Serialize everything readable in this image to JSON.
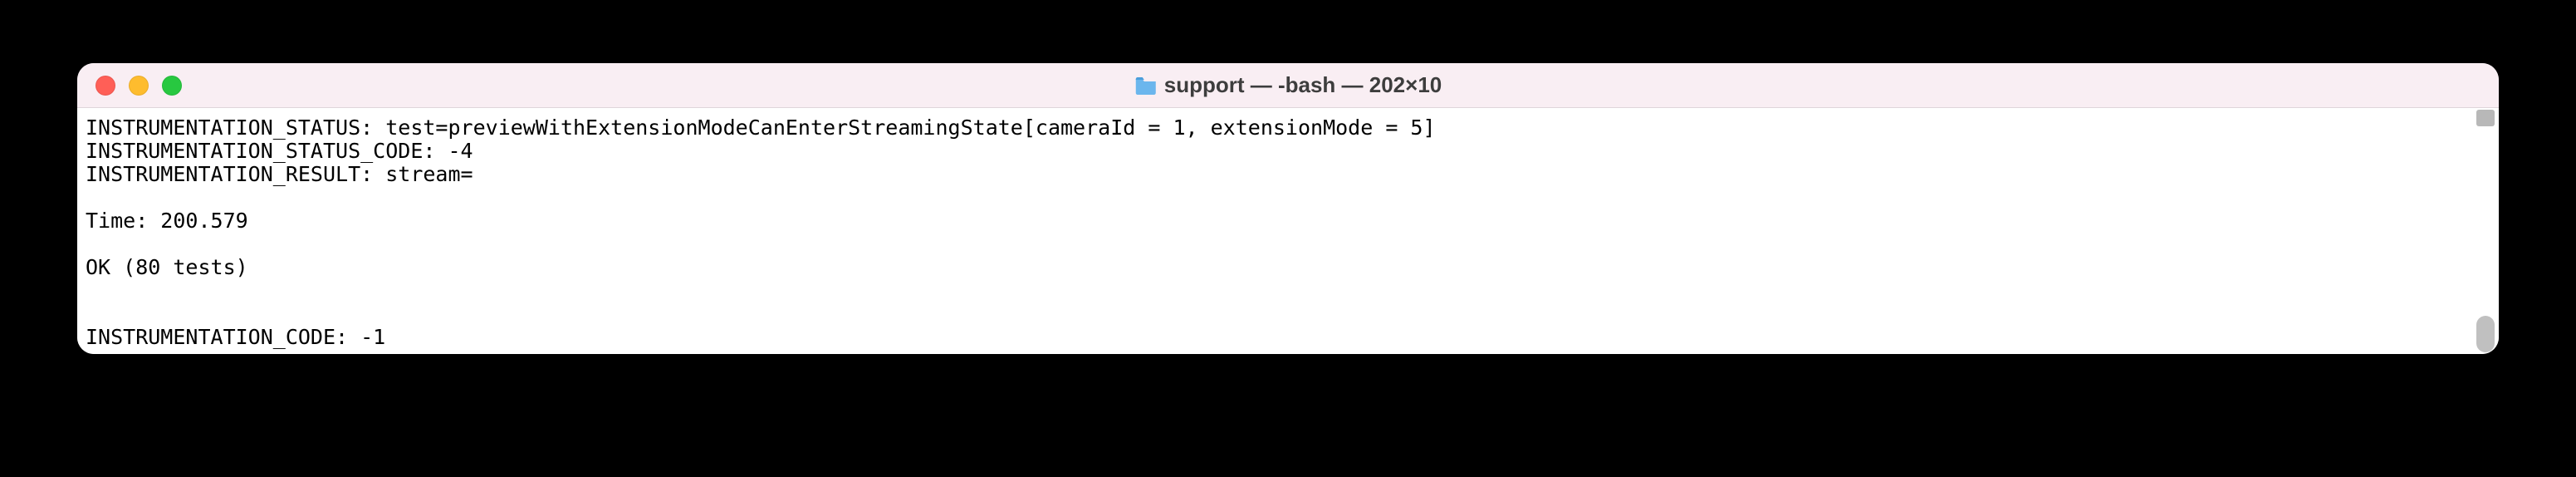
{
  "window": {
    "title": "support — -bash — 202×10",
    "folder_icon_color": "#4aa5e8"
  },
  "terminal": {
    "lines": [
      "INSTRUMENTATION_STATUS: test=previewWithExtensionModeCanEnterStreamingState[cameraId = 1, extensionMode = 5]",
      "INSTRUMENTATION_STATUS_CODE: -4",
      "INSTRUMENTATION_RESULT: stream=",
      "",
      "Time: 200.579",
      "",
      "OK (80 tests)",
      "",
      "",
      "INSTRUMENTATION_CODE: -1"
    ]
  }
}
